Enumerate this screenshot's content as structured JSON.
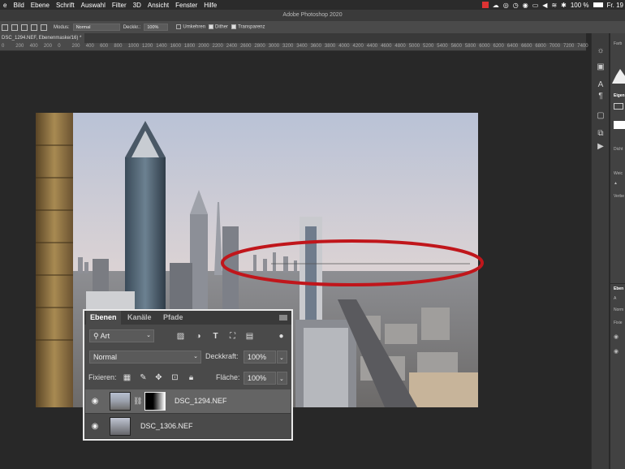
{
  "menubar": {
    "items": [
      "e",
      "Bild",
      "Ebene",
      "Schrift",
      "Auswahl",
      "Filter",
      "3D",
      "Ansicht",
      "Fenster",
      "Hilfe"
    ],
    "battery": "100 %",
    "clock": "Fr. 19"
  },
  "app_title": "Adobe Photoshop 2020",
  "options_bar": {
    "mode_label": "Modus:",
    "mode_value": "Normal",
    "opacity_label": "Deckkr.:",
    "opacity_value": "100%",
    "reverse_label": "Umkehren",
    "dither_label": "Dither",
    "transparency_label": "Transparenz",
    "reverse_checked": false,
    "dither_checked": true,
    "transparency_checked": true
  },
  "document_tab": "DSC_1294.NEF, Ebenenmaske/16) *",
  "ruler_ticks": [
    "0",
    "200",
    "400",
    "200",
    "0",
    "200",
    "400",
    "600",
    "800",
    "1000",
    "1200",
    "1400",
    "1600",
    "1800",
    "2000",
    "2200",
    "2400",
    "2600",
    "2800",
    "3000",
    "3200",
    "3400",
    "3600",
    "3800",
    "4000",
    "4200",
    "4400",
    "4600",
    "4800",
    "5000",
    "5200",
    "5400",
    "5600",
    "5800",
    "6000",
    "6200",
    "6400",
    "6600",
    "6800",
    "7000",
    "7200",
    "7400"
  ],
  "right_panel": {
    "labels": [
      "Farb",
      "Eigen",
      "Dicht",
      "Weic",
      "Verbe",
      "Eben",
      "A",
      "Norm",
      "Fixie"
    ]
  },
  "layers_panel": {
    "tabs": [
      "Ebenen",
      "Kanäle",
      "Pfade"
    ],
    "filter_value": "Art",
    "blend_mode": "Normal",
    "opacity_label": "Deckkraft:",
    "opacity_value": "100%",
    "lock_label": "Fixieren:",
    "fill_label": "Fläche:",
    "fill_value": "100%",
    "layers": [
      {
        "name": "DSC_1294.NEF",
        "selected": true,
        "has_mask": true
      },
      {
        "name": "DSC_1306.NEF",
        "selected": false,
        "has_mask": false
      }
    ]
  },
  "colors": {
    "highlight_ellipse": "#c0161b",
    "panel_bg": "#4a4a4a",
    "canvas_bg": "#282828"
  }
}
